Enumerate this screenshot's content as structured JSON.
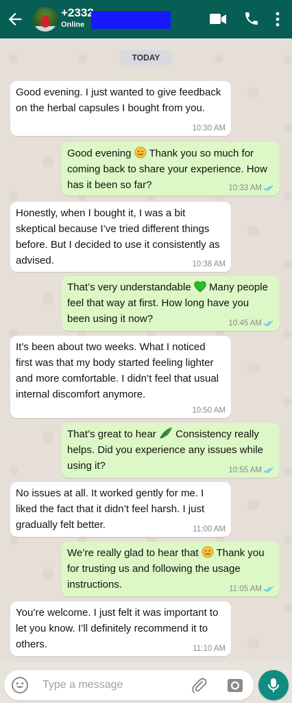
{
  "header": {
    "contact_name": "+2332",
    "status": "Online"
  },
  "chat": {
    "date_label": "TODAY",
    "messages": [
      {
        "dir": "in",
        "text": "Good evening. I just wanted to give feedback on the herbal capsules I bought from you.",
        "time": "10:30 AM"
      },
      {
        "dir": "out",
        "text_before": "Good evening",
        "emoji": "smiling-face-icon",
        "text_after": "Thank you so much for coming back to share your experience. How has it been so far?",
        "time": "10:33 AM",
        "read": true
      },
      {
        "dir": "in",
        "text": "Honestly, when I bought it, I was a bit skeptical because I’ve tried different things before. But I decided to use it consistently as advised.",
        "time": "10:38 AM"
      },
      {
        "dir": "out",
        "text_before": "That’s very understandable",
        "emoji": "green-heart-icon",
        "text_after": "Many people feel that way at first. How long have you been using it now?",
        "time": "10:45 AM",
        "read": true
      },
      {
        "dir": "in",
        "text": "It’s been about two weeks. What I noticed first was that my body started feeling lighter and more comfortable. I didn’t feel that usual internal discomfort anymore.",
        "time": "10:50 AM"
      },
      {
        "dir": "out",
        "text_before": "That’s great to hear",
        "emoji": "herb-icon",
        "text_after": "Consistency really helps. Did you experience any issues while using it?",
        "time": "10:55 AM",
        "read": true
      },
      {
        "dir": "in",
        "text": "No issues at all. It worked gently for me. I liked the fact that it didn’t feel harsh. I just gradually felt better.",
        "time": "11:00 AM"
      },
      {
        "dir": "out",
        "text_before": "We’re really glad to hear that",
        "emoji": "smiling-face-icon",
        "text_after": "Thank you for trusting us and following the usage instructions.",
        "time": "11:05 AM",
        "read": true
      },
      {
        "dir": "in",
        "text": "You’re welcome. I just felt it was important to let you know. I’ll definitely recommend it to others.",
        "time": "11:10 AM"
      }
    ]
  },
  "composer": {
    "placeholder": "Type a message"
  },
  "colors": {
    "header": "#075e54",
    "outgoing_bubble": "#dcf8c6",
    "incoming_bubble": "#ffffff",
    "read_ticks": "#4fc3f7",
    "mic_button": "#128c7e"
  }
}
